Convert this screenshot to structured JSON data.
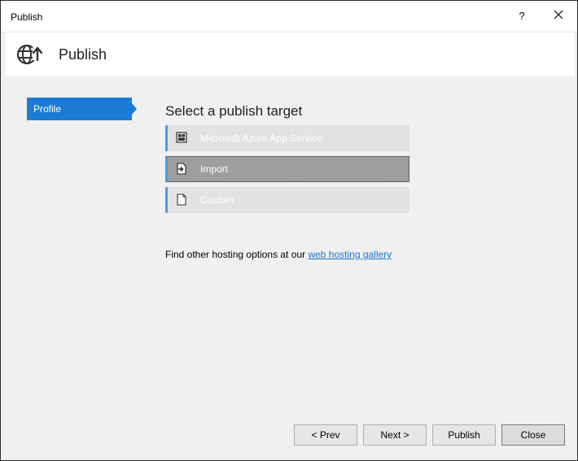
{
  "window": {
    "title": "Publish",
    "help_label": "?",
    "close_icon": "close-icon"
  },
  "header": {
    "title": "Publish",
    "icon": "globe-publish-icon"
  },
  "sidebar": {
    "items": [
      {
        "label": "Profile",
        "selected": true
      }
    ]
  },
  "main": {
    "title": "Select a publish target",
    "targets": [
      {
        "label": "Microsoft Azure App Service",
        "icon": "azure-app-service-icon",
        "selected": false
      },
      {
        "label": "Import",
        "icon": "import-icon",
        "selected": true
      },
      {
        "label": "Custom",
        "icon": "document-icon",
        "selected": false
      }
    ],
    "hosting_text": "Find other hosting options at our",
    "hosting_link": "web hosting gallery"
  },
  "footer": {
    "prev_label": "< Prev",
    "next_label": "Next >",
    "publish_label": "Publish",
    "close_label": "Close"
  },
  "colors": {
    "accent": "#1c7cd5",
    "link": "#1a73c9",
    "target_border": "#4a9be0"
  }
}
